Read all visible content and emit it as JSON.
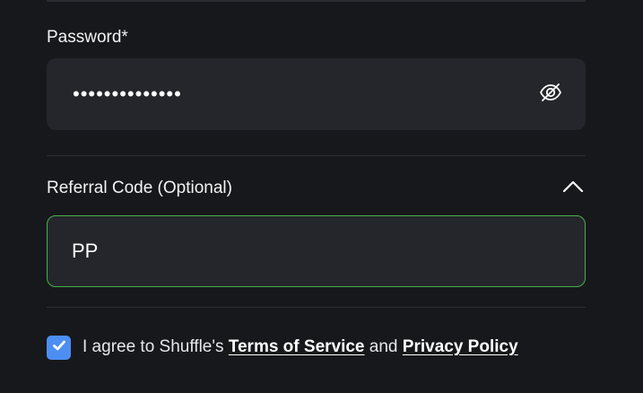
{
  "form": {
    "password": {
      "label": "Password*",
      "value_masked": "••••••••••••••",
      "toggle_icon": "eye-slash-icon"
    },
    "referral": {
      "label": "Referral Code (Optional)",
      "value": "PP",
      "expanded": true,
      "toggle_icon": "chevron-up-icon",
      "border_color": "#48b04e"
    },
    "agreement": {
      "checked": true,
      "prefix": "I agree to Shuffle's ",
      "terms_label": "Terms of Service",
      "middle": " and ",
      "privacy_label": "Privacy Policy",
      "checkbox_color": "#4d8ef2"
    }
  }
}
